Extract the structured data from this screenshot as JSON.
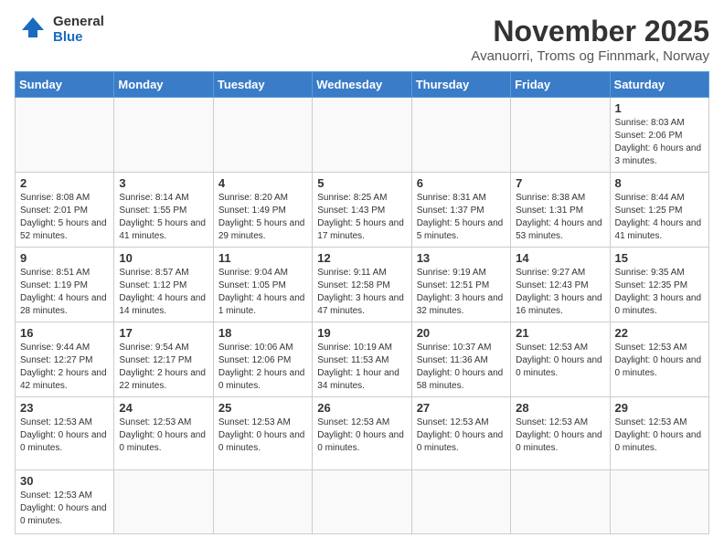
{
  "header": {
    "logo_general": "General",
    "logo_blue": "Blue",
    "month_title": "November 2025",
    "location": "Avanuorri, Troms og Finnmark, Norway"
  },
  "weekdays": [
    "Sunday",
    "Monday",
    "Tuesday",
    "Wednesday",
    "Thursday",
    "Friday",
    "Saturday"
  ],
  "weeks": [
    [
      {
        "day": "",
        "info": ""
      },
      {
        "day": "",
        "info": ""
      },
      {
        "day": "",
        "info": ""
      },
      {
        "day": "",
        "info": ""
      },
      {
        "day": "",
        "info": ""
      },
      {
        "day": "",
        "info": ""
      },
      {
        "day": "1",
        "info": "Sunrise: 8:03 AM\nSunset: 2:06 PM\nDaylight: 6 hours and 3 minutes."
      }
    ],
    [
      {
        "day": "2",
        "info": "Sunrise: 8:08 AM\nSunset: 2:01 PM\nDaylight: 5 hours and 52 minutes."
      },
      {
        "day": "3",
        "info": "Sunrise: 8:14 AM\nSunset: 1:55 PM\nDaylight: 5 hours and 41 minutes."
      },
      {
        "day": "4",
        "info": "Sunrise: 8:20 AM\nSunset: 1:49 PM\nDaylight: 5 hours and 29 minutes."
      },
      {
        "day": "5",
        "info": "Sunrise: 8:25 AM\nSunset: 1:43 PM\nDaylight: 5 hours and 17 minutes."
      },
      {
        "day": "6",
        "info": "Sunrise: 8:31 AM\nSunset: 1:37 PM\nDaylight: 5 hours and 5 minutes."
      },
      {
        "day": "7",
        "info": "Sunrise: 8:38 AM\nSunset: 1:31 PM\nDaylight: 4 hours and 53 minutes."
      },
      {
        "day": "8",
        "info": "Sunrise: 8:44 AM\nSunset: 1:25 PM\nDaylight: 4 hours and 41 minutes."
      }
    ],
    [
      {
        "day": "9",
        "info": "Sunrise: 8:51 AM\nSunset: 1:19 PM\nDaylight: 4 hours and 28 minutes."
      },
      {
        "day": "10",
        "info": "Sunrise: 8:57 AM\nSunset: 1:12 PM\nDaylight: 4 hours and 14 minutes."
      },
      {
        "day": "11",
        "info": "Sunrise: 9:04 AM\nSunset: 1:05 PM\nDaylight: 4 hours and 1 minute."
      },
      {
        "day": "12",
        "info": "Sunrise: 9:11 AM\nSunset: 12:58 PM\nDaylight: 3 hours and 47 minutes."
      },
      {
        "day": "13",
        "info": "Sunrise: 9:19 AM\nSunset: 12:51 PM\nDaylight: 3 hours and 32 minutes."
      },
      {
        "day": "14",
        "info": "Sunrise: 9:27 AM\nSunset: 12:43 PM\nDaylight: 3 hours and 16 minutes."
      },
      {
        "day": "15",
        "info": "Sunrise: 9:35 AM\nSunset: 12:35 PM\nDaylight: 3 hours and 0 minutes."
      }
    ],
    [
      {
        "day": "16",
        "info": "Sunrise: 9:44 AM\nSunset: 12:27 PM\nDaylight: 2 hours and 42 minutes."
      },
      {
        "day": "17",
        "info": "Sunrise: 9:54 AM\nSunset: 12:17 PM\nDaylight: 2 hours and 22 minutes."
      },
      {
        "day": "18",
        "info": "Sunrise: 10:06 AM\nSunset: 12:06 PM\nDaylight: 2 hours and 0 minutes."
      },
      {
        "day": "19",
        "info": "Sunrise: 10:19 AM\nSunset: 11:53 AM\nDaylight: 1 hour and 34 minutes."
      },
      {
        "day": "20",
        "info": "Sunrise: 10:37 AM\nSunset: 11:36 AM\nDaylight: 0 hours and 58 minutes."
      },
      {
        "day": "21",
        "info": "Sunset: 12:53 AM\nDaylight: 0 hours and 0 minutes."
      },
      {
        "day": "22",
        "info": "Sunset: 12:53 AM\nDaylight: 0 hours and 0 minutes."
      }
    ],
    [
      {
        "day": "23",
        "info": "Sunset: 12:53 AM\nDaylight: 0 hours and 0 minutes."
      },
      {
        "day": "24",
        "info": "Sunset: 12:53 AM\nDaylight: 0 hours and 0 minutes."
      },
      {
        "day": "25",
        "info": "Sunset: 12:53 AM\nDaylight: 0 hours and 0 minutes."
      },
      {
        "day": "26",
        "info": "Sunset: 12:53 AM\nDaylight: 0 hours and 0 minutes."
      },
      {
        "day": "27",
        "info": "Sunset: 12:53 AM\nDaylight: 0 hours and 0 minutes."
      },
      {
        "day": "28",
        "info": "Sunset: 12:53 AM\nDaylight: 0 hours and 0 minutes."
      },
      {
        "day": "29",
        "info": "Sunset: 12:53 AM\nDaylight: 0 hours and 0 minutes."
      }
    ],
    [
      {
        "day": "30",
        "info": "Sunset: 12:53 AM\nDaylight: 0 hours and 0 minutes."
      },
      {
        "day": "",
        "info": ""
      },
      {
        "day": "",
        "info": ""
      },
      {
        "day": "",
        "info": ""
      },
      {
        "day": "",
        "info": ""
      },
      {
        "day": "",
        "info": ""
      },
      {
        "day": "",
        "info": ""
      }
    ]
  ]
}
